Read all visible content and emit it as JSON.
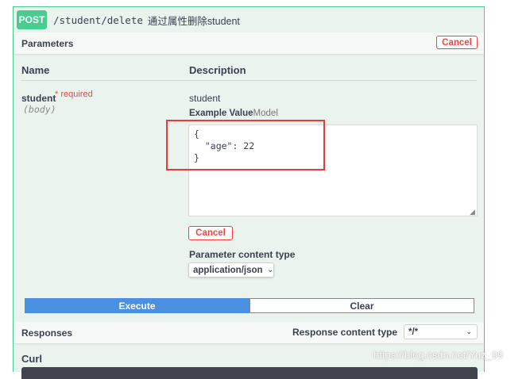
{
  "operation": {
    "method": "POST",
    "path": "/student/delete",
    "summary": "通过属性删除student"
  },
  "parameters_section": {
    "title": "Parameters",
    "cancel_label": "Cancel"
  },
  "table": {
    "name_header": "Name",
    "description_header": "Description"
  },
  "param": {
    "name": "student",
    "required_label": "* required",
    "location": "(body)",
    "description": "student",
    "example_tab": "Example Value",
    "model_tab": "Model",
    "body_value": "{\n  \"age\": 22\n}",
    "cancel_label": "Cancel",
    "content_type_label": "Parameter content type",
    "content_type_value": "application/json"
  },
  "actions": {
    "execute_label": "Execute",
    "clear_label": "Clear"
  },
  "responses_section": {
    "title": "Responses",
    "content_type_label": "Response content type",
    "content_type_value": "*/*"
  },
  "curl": {
    "title": "Curl"
  },
  "watermark": "https://blog.csdn.net/Yuz_99",
  "colors": {
    "post_green": "#49cc90",
    "cancel_red": "#f93e3e",
    "execute_blue": "#4990e2",
    "highlight_red": "#e83a3a"
  }
}
